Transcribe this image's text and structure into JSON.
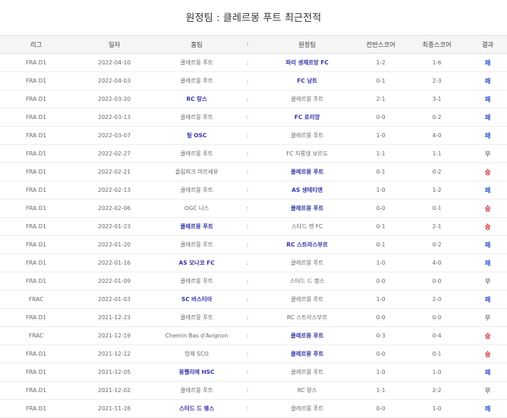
{
  "title": "원정팀 : 클레르몽 푸트 최근전적",
  "columns": [
    "리그",
    "일자",
    "홈팀",
    ":",
    "원정팀",
    "전반스코어",
    "최종스코어",
    "결과"
  ],
  "rows": [
    {
      "league": "FRA D1",
      "date": "2022-04-10",
      "home": "클레르몽 푸트",
      "sep": ":",
      "away": "파리 생제르망 FC",
      "half": "1-2",
      "final": "1-6",
      "result": "패",
      "winner": "away",
      "type": "loss"
    },
    {
      "league": "FRA D1",
      "date": "2022-04-03",
      "home": "클레르몽 푸트",
      "sep": ":",
      "away": "FC 낭트",
      "half": "0-1",
      "final": "2-3",
      "result": "패",
      "winner": "away",
      "type": "loss"
    },
    {
      "league": "FRA D1",
      "date": "2022-03-20",
      "home": "RC 랑스",
      "sep": ":",
      "away": "클레르몽 푸트",
      "half": "2-1",
      "final": "3-1",
      "result": "패",
      "winner": "home",
      "type": "loss"
    },
    {
      "league": "FRA D1",
      "date": "2022-03-13",
      "home": "클레르몽 푸트",
      "sep": ":",
      "away": "FC 로리앙",
      "half": "0-0",
      "final": "0-2",
      "result": "패",
      "winner": "away",
      "type": "loss"
    },
    {
      "league": "FRA D1",
      "date": "2022-03-07",
      "home": "릴 OSC",
      "sep": ":",
      "away": "클레르몽 푸트",
      "half": "1-0",
      "final": "4-0",
      "result": "패",
      "winner": "home",
      "type": "loss"
    },
    {
      "league": "FRA D1",
      "date": "2022-02-27",
      "home": "클레르몽 푸트",
      "sep": ":",
      "away": "FC 지롱댕 보르도",
      "half": "1-1",
      "final": "1-1",
      "result": "무",
      "winner": "none",
      "type": "draw"
    },
    {
      "league": "FRA D1",
      "date": "2022-02-21",
      "home": "올림피크 마르세유",
      "sep": ":",
      "away": "클레르몽 푸트",
      "half": "0-1",
      "final": "0-2",
      "result": "승",
      "winner": "away",
      "type": "win"
    },
    {
      "league": "FRA D1",
      "date": "2022-02-13",
      "home": "클레르몽 푸트",
      "sep": ":",
      "away": "AS 생테티엔",
      "half": "1-0",
      "final": "1-2",
      "result": "패",
      "winner": "away",
      "type": "loss"
    },
    {
      "league": "FRA D1",
      "date": "2022-02-06",
      "home": "OGC 니스",
      "sep": ":",
      "away": "클레르몽 푸트",
      "half": "0-0",
      "final": "0-1",
      "result": "승",
      "winner": "away",
      "type": "win"
    },
    {
      "league": "FRA D1",
      "date": "2022-01-23",
      "home": "클레르몽 푸트",
      "sep": ":",
      "away": "스타드 렌 FC",
      "half": "0-1",
      "final": "2-1",
      "result": "승",
      "winner": "home",
      "type": "win"
    },
    {
      "league": "FRA D1",
      "date": "2022-01-20",
      "home": "클레르몽 푸트",
      "sep": ":",
      "away": "RC 스트라스부르",
      "half": "0-1",
      "final": "0-2",
      "result": "패",
      "winner": "away",
      "type": "loss"
    },
    {
      "league": "FRA D1",
      "date": "2022-01-16",
      "home": "AS 모나코 FC",
      "sep": ":",
      "away": "클레르몽 푸트",
      "half": "1-0",
      "final": "4-0",
      "result": "패",
      "winner": "home",
      "type": "loss"
    },
    {
      "league": "FRA D1",
      "date": "2022-01-09",
      "home": "클레르몽 푸트",
      "sep": ":",
      "away": "스타드 드 랭스",
      "half": "0-0",
      "final": "0-0",
      "result": "무",
      "winner": "none",
      "type": "draw"
    },
    {
      "league": "FRAC",
      "date": "2022-01-03",
      "home": "SC 바스티아",
      "sep": ":",
      "away": "클레르몽 푸트",
      "half": "1-0",
      "final": "2-0",
      "result": "패",
      "winner": "home",
      "type": "loss"
    },
    {
      "league": "FRA D1",
      "date": "2021-12-23",
      "home": "클레르몽 푸트",
      "sep": ":",
      "away": "RC 스트라스부르",
      "half": "0-0",
      "final": "0-0",
      "result": "무",
      "winner": "none",
      "type": "draw"
    },
    {
      "league": "FRAC",
      "date": "2021-12-19",
      "home": "Chemin Bas d'Avignon",
      "sep": ":",
      "away": "클레르몽 푸트",
      "half": "0-3",
      "final": "0-4",
      "result": "승",
      "winner": "away",
      "type": "win"
    },
    {
      "league": "FRA D1",
      "date": "2021-12-12",
      "home": "앙제 SCO",
      "sep": ":",
      "away": "클레르몽 푸트",
      "half": "0-0",
      "final": "0-1",
      "result": "승",
      "winner": "away",
      "type": "win"
    },
    {
      "league": "FRA D1",
      "date": "2021-12-05",
      "home": "몽펠리에 HSC",
      "sep": ":",
      "away": "클레르몽 푸트",
      "half": "1-0",
      "final": "1-0",
      "result": "패",
      "winner": "home",
      "type": "loss"
    },
    {
      "league": "FRA D1",
      "date": "2021-12-02",
      "home": "클레르몽 푸트",
      "sep": ":",
      "away": "RC 랑스",
      "half": "1-1",
      "final": "2-2",
      "result": "무",
      "winner": "none",
      "type": "draw"
    },
    {
      "league": "FRA D1",
      "date": "2021-11-28",
      "home": "스타드 드 랭스",
      "sep": ":",
      "away": "클레르몽 푸트",
      "half": "0-0",
      "final": "1-0",
      "result": "패",
      "winner": "home",
      "type": "loss"
    }
  ]
}
